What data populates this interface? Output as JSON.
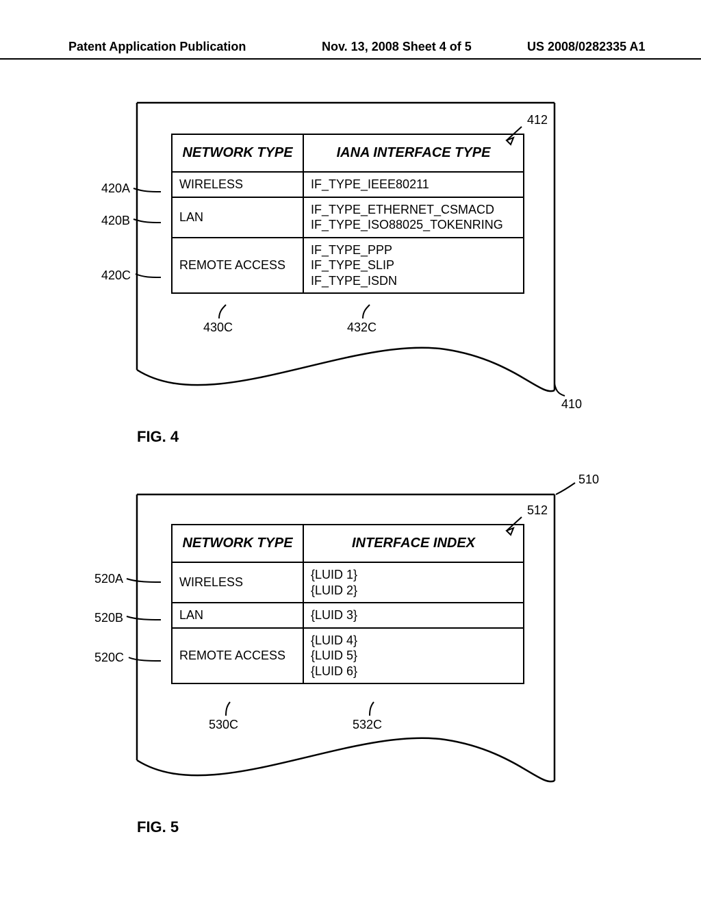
{
  "header": {
    "left": "Patent Application Publication",
    "mid": "Nov. 13, 2008  Sheet 4 of 5",
    "right": "US 2008/0282335 A1"
  },
  "fig4": {
    "caption": "FIG. 4",
    "table_callout": "412",
    "sheet_callout": "410",
    "row_labels": [
      "420A",
      "420B",
      "420C"
    ],
    "col_below": [
      "430C",
      "432C"
    ],
    "headers": [
      "NETWORK TYPE",
      "IANA INTERFACE TYPE"
    ],
    "rows": [
      {
        "c1": "WIRELESS",
        "c2": "IF_TYPE_IEEE80211"
      },
      {
        "c1": "LAN",
        "c2": "IF_TYPE_ETHERNET_CSMACD\nIF_TYPE_ISO88025_TOKENRING"
      },
      {
        "c1": "REMOTE ACCESS",
        "c2": "IF_TYPE_PPP\nIF_TYPE_SLIP\nIF_TYPE_ISDN"
      }
    ]
  },
  "fig5": {
    "caption": "FIG. 5",
    "table_callout": "512",
    "sheet_callout": "510",
    "row_labels": [
      "520A",
      "520B",
      "520C"
    ],
    "col_below": [
      "530C",
      "532C"
    ],
    "headers": [
      "NETWORK TYPE",
      "INTERFACE INDEX"
    ],
    "rows": [
      {
        "c1": "WIRELESS",
        "c2": "{LUID 1}\n{LUID 2}"
      },
      {
        "c1": "LAN",
        "c2": "{LUID 3}"
      },
      {
        "c1": "REMOTE ACCESS",
        "c2": "{LUID 4}\n{LUID 5}\n{LUID 6}"
      }
    ]
  }
}
